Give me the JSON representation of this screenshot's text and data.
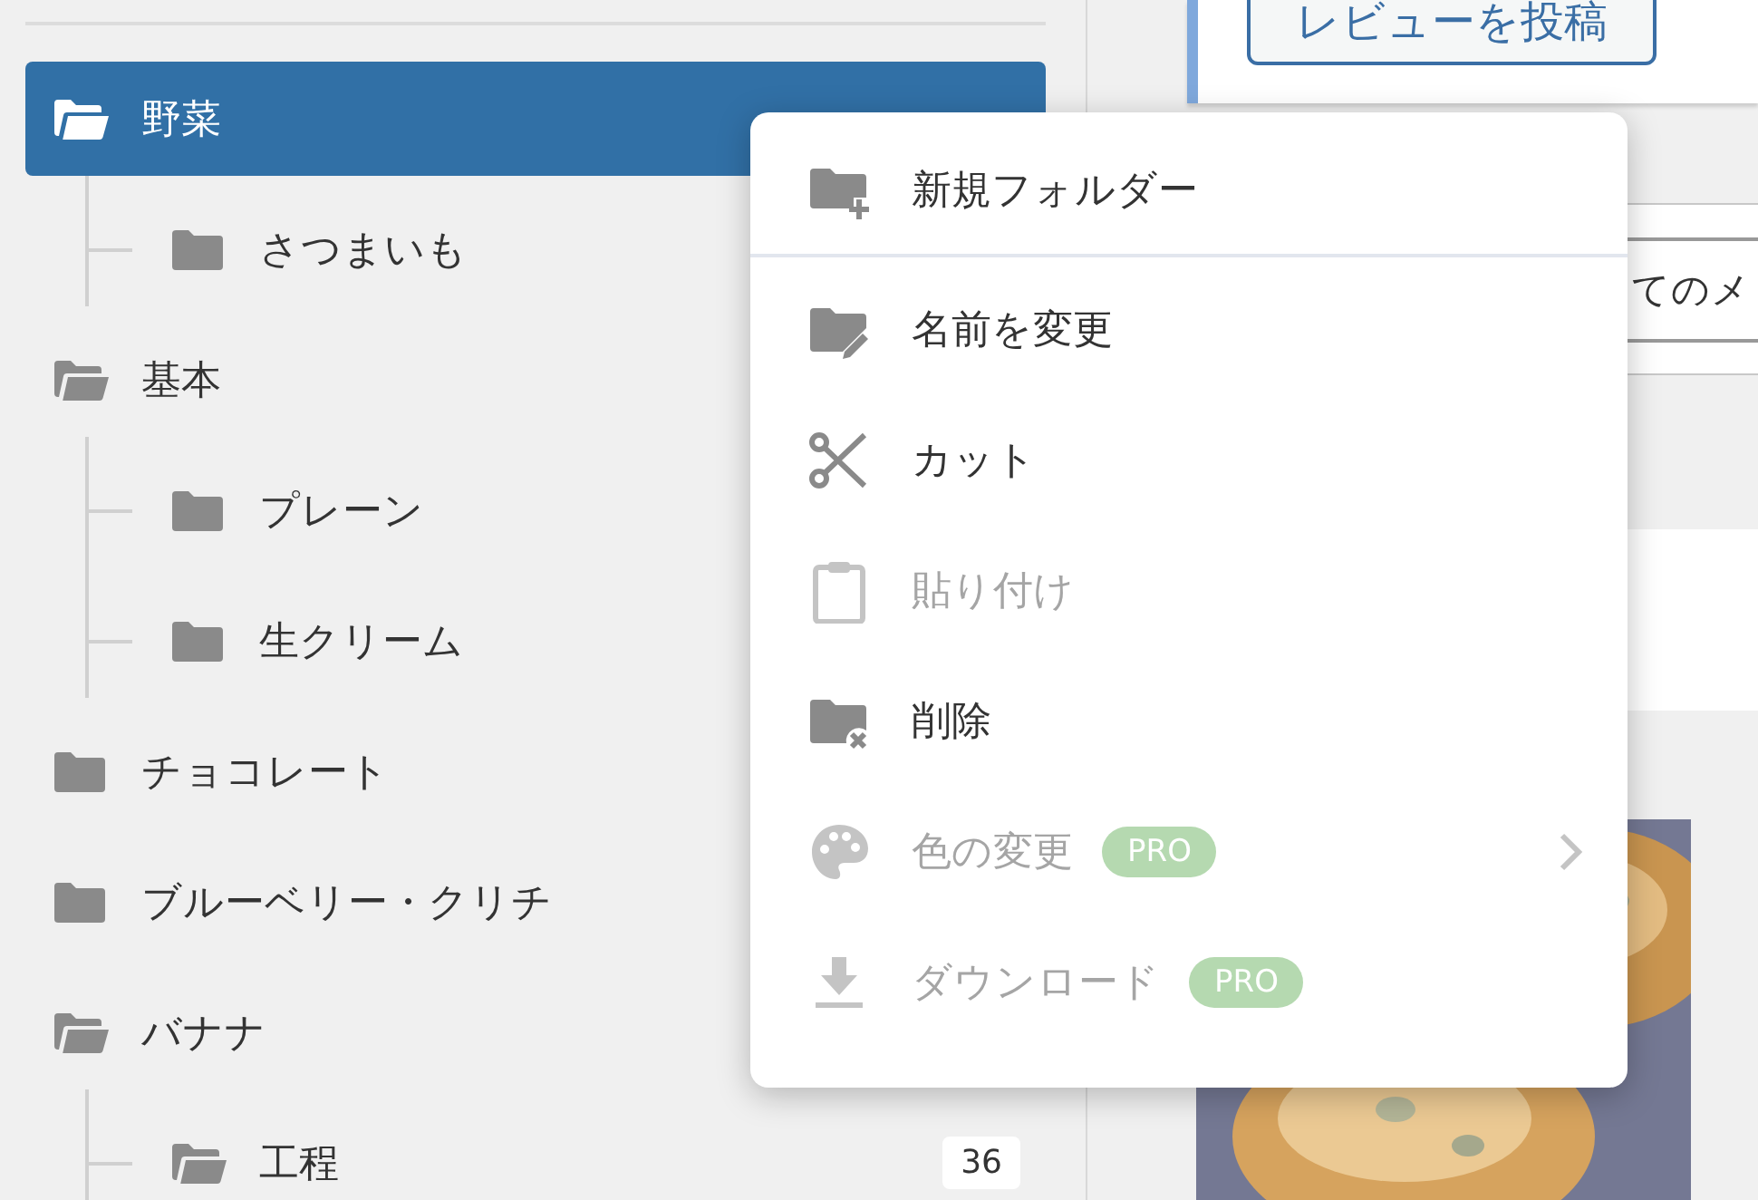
{
  "tree": [
    {
      "label": "野菜",
      "expanded": true,
      "selected": true,
      "children": [
        {
          "label": "さつまいも",
          "expanded": false,
          "selected": false
        }
      ]
    },
    {
      "label": "基本",
      "expanded": true,
      "selected": false,
      "children": [
        {
          "label": "プレーン",
          "expanded": false,
          "selected": false
        },
        {
          "label": "生クリーム",
          "expanded": false,
          "selected": false
        }
      ]
    },
    {
      "label": "チョコレート",
      "expanded": false,
      "selected": false
    },
    {
      "label": "ブルーベリー・クリチ",
      "expanded": false,
      "selected": false
    },
    {
      "label": "バナナ",
      "expanded": true,
      "selected": false,
      "children": [
        {
          "label": "工程",
          "expanded": true,
          "selected": false,
          "count": "36"
        }
      ]
    }
  ],
  "review_button": "レビューを投稿",
  "select_field": {
    "value": "てのメ"
  },
  "context_menu": [
    {
      "kind": "new-folder",
      "label": "新規フォルダー",
      "disabled": false,
      "divider_after": true,
      "submenu": false
    },
    {
      "kind": "rename",
      "label": "名前を変更",
      "disabled": false,
      "divider_after": false,
      "submenu": false
    },
    {
      "kind": "cut",
      "label": "カット",
      "disabled": false,
      "divider_after": false,
      "submenu": false
    },
    {
      "kind": "paste",
      "label": "貼り付け",
      "disabled": true,
      "divider_after": false,
      "submenu": false
    },
    {
      "kind": "delete",
      "label": "削除",
      "disabled": false,
      "divider_after": false,
      "submenu": false
    },
    {
      "kind": "color",
      "label": "色の変更",
      "disabled": true,
      "badge": "PRO",
      "divider_after": false,
      "submenu": true
    },
    {
      "kind": "download",
      "label": "ダウンロード",
      "disabled": true,
      "badge": "PRO",
      "divider_after": false,
      "submenu": false
    }
  ]
}
